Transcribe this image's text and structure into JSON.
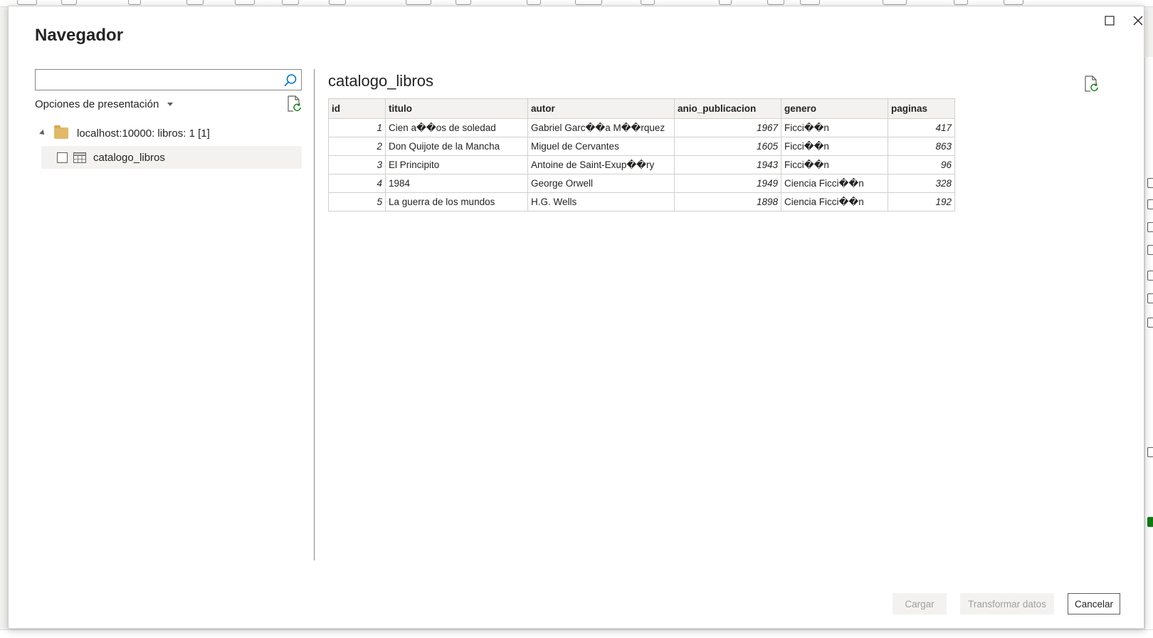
{
  "dialog": {
    "title": "Navegador"
  },
  "search": {
    "value": "",
    "placeholder": ""
  },
  "display_options": {
    "label": "Opciones de presentación"
  },
  "tree": {
    "server": {
      "label": "localhost:10000: libros: 1 [1]",
      "expanded": true
    },
    "items": [
      {
        "label": "catalogo_libros",
        "checked": false
      }
    ]
  },
  "preview": {
    "title": "catalogo_libros",
    "columns": [
      "id",
      "titulo",
      "autor",
      "anio_publicacion",
      "genero",
      "paginas"
    ],
    "rows": [
      [
        "1",
        "Cien a��os de soledad",
        "Gabriel Garc��a M��rquez",
        "1967",
        "Ficci��n",
        "417"
      ],
      [
        "2",
        "Don Quijote de la Mancha",
        "Miguel de Cervantes",
        "1605",
        "Ficci��n",
        "863"
      ],
      [
        "3",
        "El Principito",
        "Antoine de Saint-Exup��ry",
        "1943",
        "Ficci��n",
        "96"
      ],
      [
        "4",
        "1984",
        "George Orwell",
        "1949",
        "Ciencia Ficci��n",
        "328"
      ],
      [
        "5",
        "La guerra de los mundos",
        "H.G. Wells",
        "1898",
        "Ciencia Ficci��n",
        "192"
      ]
    ]
  },
  "footer": {
    "load_label": "Cargar",
    "transform_label": "Transformar datos",
    "cancel_label": "Cancelar"
  },
  "icons": {
    "search": "search-icon",
    "refresh": "refresh-icon",
    "folder": "folder-icon",
    "table": "table-icon",
    "maximize": "maximize-icon",
    "close": "close-icon"
  },
  "colors": {
    "dialog_bg": "#ffffff",
    "header_bg": "#f3f2f1",
    "selected_bg": "#f3f2f1",
    "border": "#d2d0ce",
    "disabled_text": "#a19f9d",
    "folder": "#e2b968"
  }
}
